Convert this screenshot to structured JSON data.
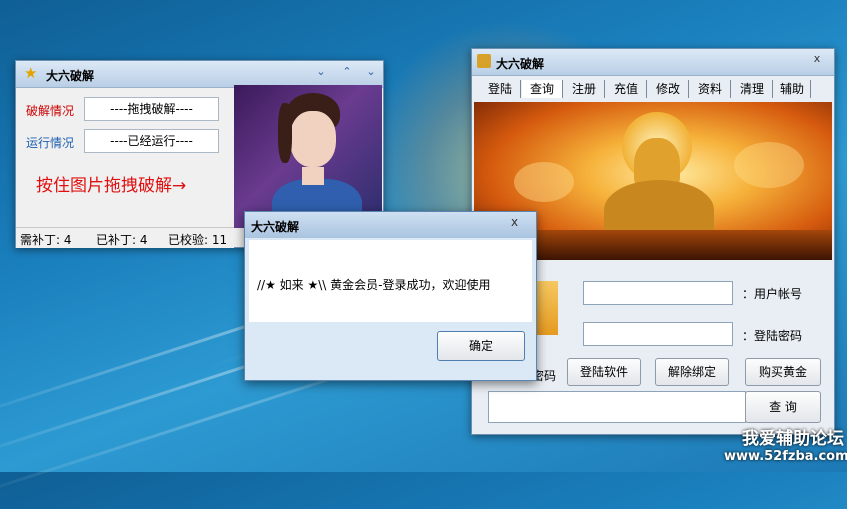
{
  "left_window": {
    "title": "大六破解",
    "rows": [
      {
        "label": "破解情况",
        "value": "----拖拽破解----"
      },
      {
        "label": "运行情况",
        "value": "----已经运行----"
      }
    ],
    "hint": "按住图片拖拽破解→",
    "status": [
      "需补丁: 4",
      "已补丁: 4",
      "已校验: 11"
    ]
  },
  "right_window": {
    "title": "大六破解",
    "close": "x",
    "tabs": [
      "登陆",
      "查询",
      "注册",
      "充值",
      "修改",
      "资料",
      "清理",
      "辅助"
    ],
    "labels": {
      "user": "：用户帐号",
      "password": "：登陆密码",
      "partial": "密码"
    },
    "buttons": {
      "login": "登陆软件",
      "unbind": "解除绑定",
      "buy": "购买黄金",
      "query": "查 询"
    }
  },
  "dialog": {
    "title": "大六破解",
    "close": "x",
    "message": "//★ 如来 ★\\\\ 黄金会员-登录成功，欢迎使用",
    "ok": "确定"
  },
  "watermark": {
    "line1": "我爱辅助论坛",
    "line2": "www.52fzba.com"
  },
  "colors": {
    "label_red": "#cc0000",
    "label_blue": "#1d5fb0",
    "hint_red": "#e01010"
  }
}
